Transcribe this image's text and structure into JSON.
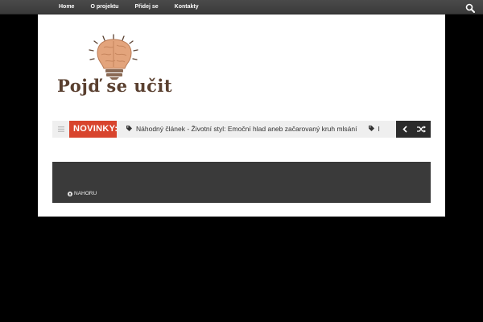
{
  "nav": {
    "items": [
      {
        "label": "Home"
      },
      {
        "label": "O projektu"
      },
      {
        "label": "Přidej se"
      },
      {
        "label": "Kontakty"
      }
    ],
    "search_icon": "search-icon"
  },
  "logo": {
    "text": "Pojď se učit",
    "icon": "lightbulb-brain-icon"
  },
  "ticker": {
    "menu_icon": "menu-icon",
    "label": "NOVINKY:",
    "items": [
      {
        "text": "Náhodný článek - Životní styl: Emoční hlad aneb začarovaný kruh mlsání"
      },
      {
        "text": "I"
      }
    ],
    "prev_icon": "chevron-left-icon",
    "shuffle_icon": "shuffle-icon"
  },
  "footer": {
    "back_to_top": "NAHORU"
  },
  "colors": {
    "accent": "#d8442d",
    "topbar": "#3f3f3f",
    "footer": "#3a3a3a",
    "logo_text": "#5a4030",
    "brain": "#e3a47c"
  }
}
